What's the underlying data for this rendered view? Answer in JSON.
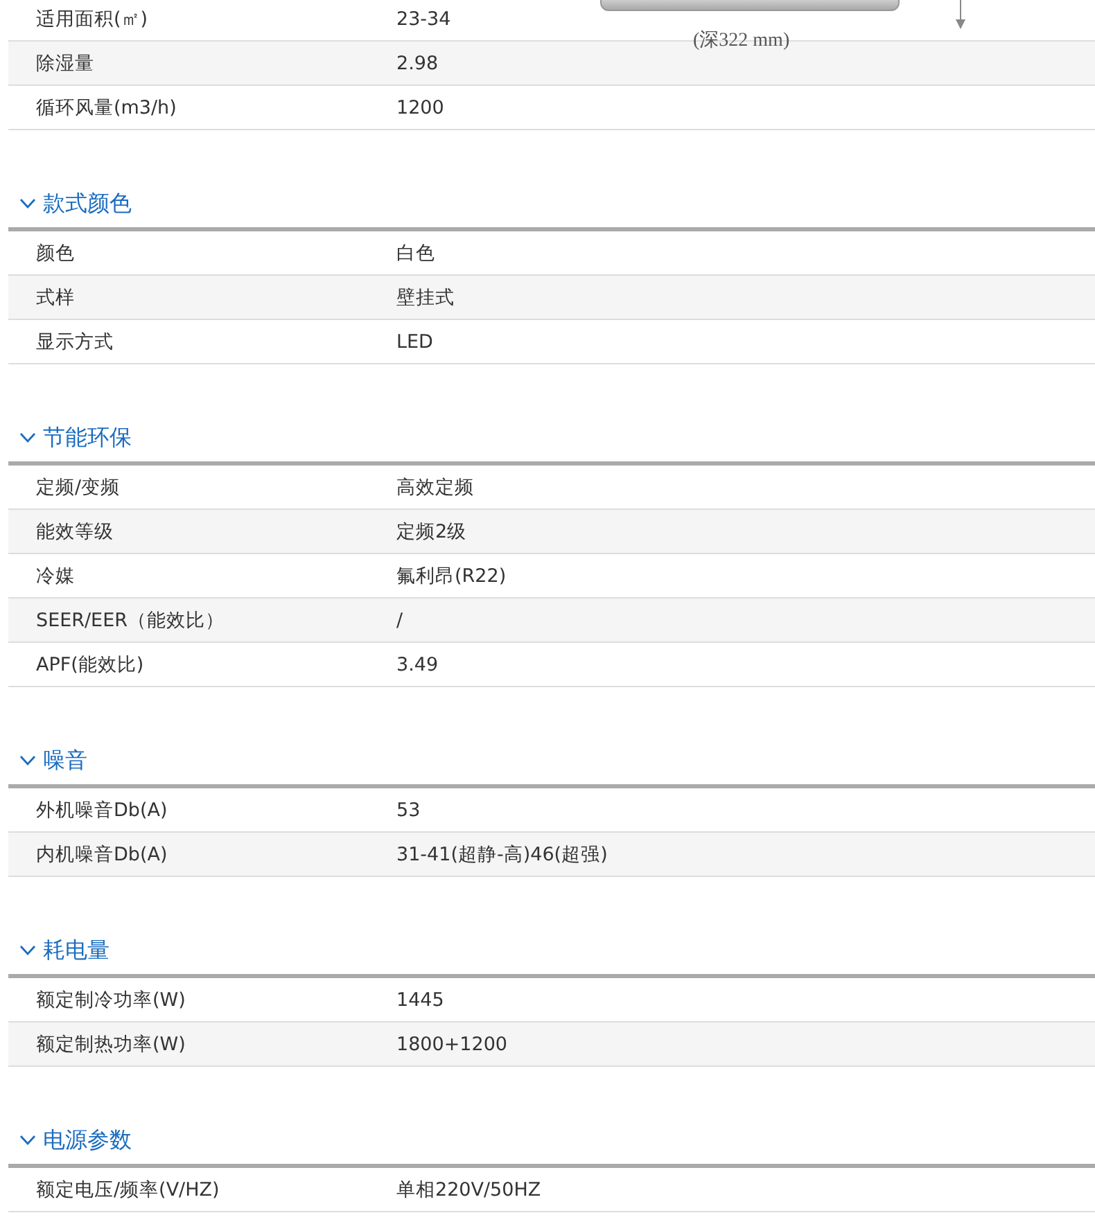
{
  "drawing": {
    "caption": "(深322 mm)"
  },
  "sections": [
    {
      "rows": [
        {
          "label": "适用面积(㎡)",
          "value": "23-34"
        },
        {
          "label": "除湿量",
          "value": "2.98"
        },
        {
          "label": "循环风量(m3/h)",
          "value": "1200"
        }
      ]
    },
    {
      "title": "款式颜色",
      "expanded": true,
      "rows": [
        {
          "label": "颜色",
          "value": "白色"
        },
        {
          "label": "式样",
          "value": "壁挂式"
        },
        {
          "label": "显示方式",
          "value": "LED"
        }
      ]
    },
    {
      "title": "节能环保",
      "expanded": true,
      "rows": [
        {
          "label": "定频/变频",
          "value": "高效定频"
        },
        {
          "label": "能效等级",
          "value": "定频2级"
        },
        {
          "label": "冷媒",
          "value": "氟利昂(R22)"
        },
        {
          "label": "SEER/EER（能效比）",
          "value": "/"
        },
        {
          "label": "APF(能效比)",
          "value": "3.49"
        }
      ]
    },
    {
      "title": "噪音",
      "expanded": true,
      "rows": [
        {
          "label": "外机噪音Db(A)",
          "value": "53"
        },
        {
          "label": "内机噪音Db(A)",
          "value": "31-41(超静-高)46(超强)"
        }
      ]
    },
    {
      "title": "耗电量",
      "expanded": true,
      "rows": [
        {
          "label": "额定制冷功率(W)",
          "value": "1445"
        },
        {
          "label": "额定制热功率(W)",
          "value": "1800+1200"
        }
      ]
    },
    {
      "title": "电源参数",
      "expanded": true,
      "rows": [
        {
          "label": "额定电压/频率(V/HZ)",
          "value": "单相220V/50HZ"
        }
      ]
    }
  ]
}
